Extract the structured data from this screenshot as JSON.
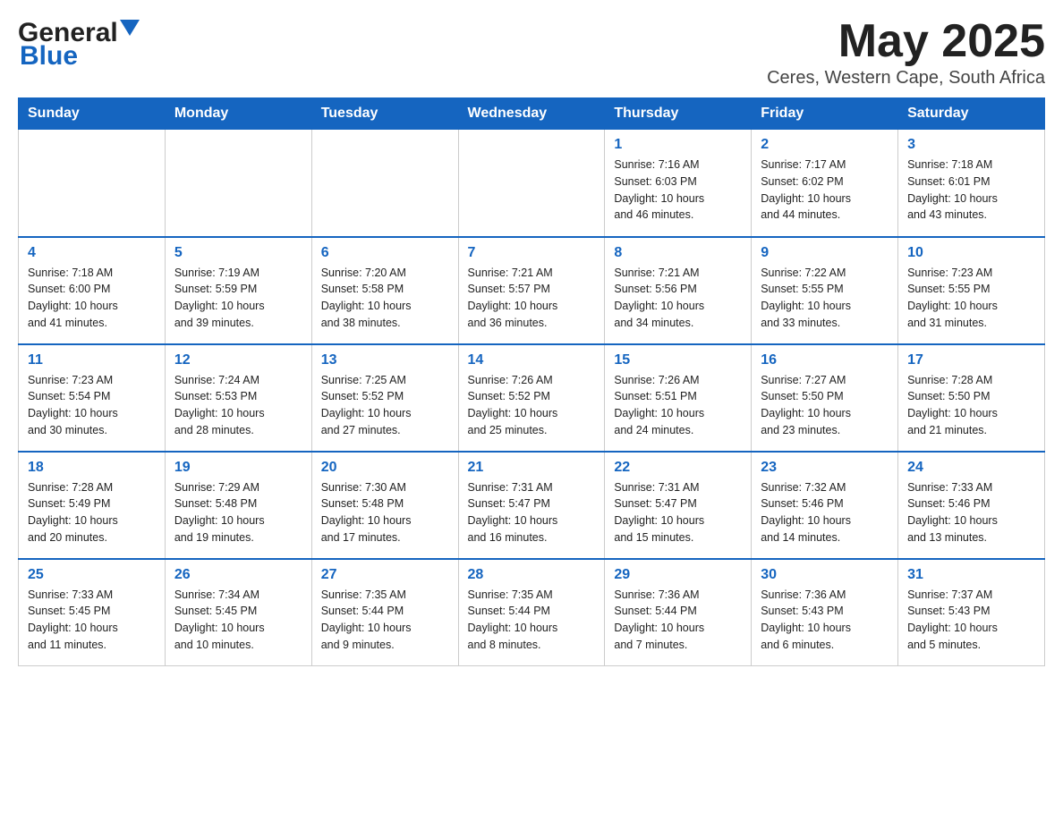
{
  "header": {
    "logo_general": "General",
    "logo_blue": "Blue",
    "month_title": "May 2025",
    "subtitle": "Ceres, Western Cape, South Africa"
  },
  "days_of_week": [
    "Sunday",
    "Monday",
    "Tuesday",
    "Wednesday",
    "Thursday",
    "Friday",
    "Saturday"
  ],
  "weeks": [
    [
      {
        "day": "",
        "info": []
      },
      {
        "day": "",
        "info": []
      },
      {
        "day": "",
        "info": []
      },
      {
        "day": "",
        "info": []
      },
      {
        "day": "1",
        "info": [
          "Sunrise: 7:16 AM",
          "Sunset: 6:03 PM",
          "Daylight: 10 hours",
          "and 46 minutes."
        ]
      },
      {
        "day": "2",
        "info": [
          "Sunrise: 7:17 AM",
          "Sunset: 6:02 PM",
          "Daylight: 10 hours",
          "and 44 minutes."
        ]
      },
      {
        "day": "3",
        "info": [
          "Sunrise: 7:18 AM",
          "Sunset: 6:01 PM",
          "Daylight: 10 hours",
          "and 43 minutes."
        ]
      }
    ],
    [
      {
        "day": "4",
        "info": [
          "Sunrise: 7:18 AM",
          "Sunset: 6:00 PM",
          "Daylight: 10 hours",
          "and 41 minutes."
        ]
      },
      {
        "day": "5",
        "info": [
          "Sunrise: 7:19 AM",
          "Sunset: 5:59 PM",
          "Daylight: 10 hours",
          "and 39 minutes."
        ]
      },
      {
        "day": "6",
        "info": [
          "Sunrise: 7:20 AM",
          "Sunset: 5:58 PM",
          "Daylight: 10 hours",
          "and 38 minutes."
        ]
      },
      {
        "day": "7",
        "info": [
          "Sunrise: 7:21 AM",
          "Sunset: 5:57 PM",
          "Daylight: 10 hours",
          "and 36 minutes."
        ]
      },
      {
        "day": "8",
        "info": [
          "Sunrise: 7:21 AM",
          "Sunset: 5:56 PM",
          "Daylight: 10 hours",
          "and 34 minutes."
        ]
      },
      {
        "day": "9",
        "info": [
          "Sunrise: 7:22 AM",
          "Sunset: 5:55 PM",
          "Daylight: 10 hours",
          "and 33 minutes."
        ]
      },
      {
        "day": "10",
        "info": [
          "Sunrise: 7:23 AM",
          "Sunset: 5:55 PM",
          "Daylight: 10 hours",
          "and 31 minutes."
        ]
      }
    ],
    [
      {
        "day": "11",
        "info": [
          "Sunrise: 7:23 AM",
          "Sunset: 5:54 PM",
          "Daylight: 10 hours",
          "and 30 minutes."
        ]
      },
      {
        "day": "12",
        "info": [
          "Sunrise: 7:24 AM",
          "Sunset: 5:53 PM",
          "Daylight: 10 hours",
          "and 28 minutes."
        ]
      },
      {
        "day": "13",
        "info": [
          "Sunrise: 7:25 AM",
          "Sunset: 5:52 PM",
          "Daylight: 10 hours",
          "and 27 minutes."
        ]
      },
      {
        "day": "14",
        "info": [
          "Sunrise: 7:26 AM",
          "Sunset: 5:52 PM",
          "Daylight: 10 hours",
          "and 25 minutes."
        ]
      },
      {
        "day": "15",
        "info": [
          "Sunrise: 7:26 AM",
          "Sunset: 5:51 PM",
          "Daylight: 10 hours",
          "and 24 minutes."
        ]
      },
      {
        "day": "16",
        "info": [
          "Sunrise: 7:27 AM",
          "Sunset: 5:50 PM",
          "Daylight: 10 hours",
          "and 23 minutes."
        ]
      },
      {
        "day": "17",
        "info": [
          "Sunrise: 7:28 AM",
          "Sunset: 5:50 PM",
          "Daylight: 10 hours",
          "and 21 minutes."
        ]
      }
    ],
    [
      {
        "day": "18",
        "info": [
          "Sunrise: 7:28 AM",
          "Sunset: 5:49 PM",
          "Daylight: 10 hours",
          "and 20 minutes."
        ]
      },
      {
        "day": "19",
        "info": [
          "Sunrise: 7:29 AM",
          "Sunset: 5:48 PM",
          "Daylight: 10 hours",
          "and 19 minutes."
        ]
      },
      {
        "day": "20",
        "info": [
          "Sunrise: 7:30 AM",
          "Sunset: 5:48 PM",
          "Daylight: 10 hours",
          "and 17 minutes."
        ]
      },
      {
        "day": "21",
        "info": [
          "Sunrise: 7:31 AM",
          "Sunset: 5:47 PM",
          "Daylight: 10 hours",
          "and 16 minutes."
        ]
      },
      {
        "day": "22",
        "info": [
          "Sunrise: 7:31 AM",
          "Sunset: 5:47 PM",
          "Daylight: 10 hours",
          "and 15 minutes."
        ]
      },
      {
        "day": "23",
        "info": [
          "Sunrise: 7:32 AM",
          "Sunset: 5:46 PM",
          "Daylight: 10 hours",
          "and 14 minutes."
        ]
      },
      {
        "day": "24",
        "info": [
          "Sunrise: 7:33 AM",
          "Sunset: 5:46 PM",
          "Daylight: 10 hours",
          "and 13 minutes."
        ]
      }
    ],
    [
      {
        "day": "25",
        "info": [
          "Sunrise: 7:33 AM",
          "Sunset: 5:45 PM",
          "Daylight: 10 hours",
          "and 11 minutes."
        ]
      },
      {
        "day": "26",
        "info": [
          "Sunrise: 7:34 AM",
          "Sunset: 5:45 PM",
          "Daylight: 10 hours",
          "and 10 minutes."
        ]
      },
      {
        "day": "27",
        "info": [
          "Sunrise: 7:35 AM",
          "Sunset: 5:44 PM",
          "Daylight: 10 hours",
          "and 9 minutes."
        ]
      },
      {
        "day": "28",
        "info": [
          "Sunrise: 7:35 AM",
          "Sunset: 5:44 PM",
          "Daylight: 10 hours",
          "and 8 minutes."
        ]
      },
      {
        "day": "29",
        "info": [
          "Sunrise: 7:36 AM",
          "Sunset: 5:44 PM",
          "Daylight: 10 hours",
          "and 7 minutes."
        ]
      },
      {
        "day": "30",
        "info": [
          "Sunrise: 7:36 AM",
          "Sunset: 5:43 PM",
          "Daylight: 10 hours",
          "and 6 minutes."
        ]
      },
      {
        "day": "31",
        "info": [
          "Sunrise: 7:37 AM",
          "Sunset: 5:43 PM",
          "Daylight: 10 hours",
          "and 5 minutes."
        ]
      }
    ]
  ]
}
